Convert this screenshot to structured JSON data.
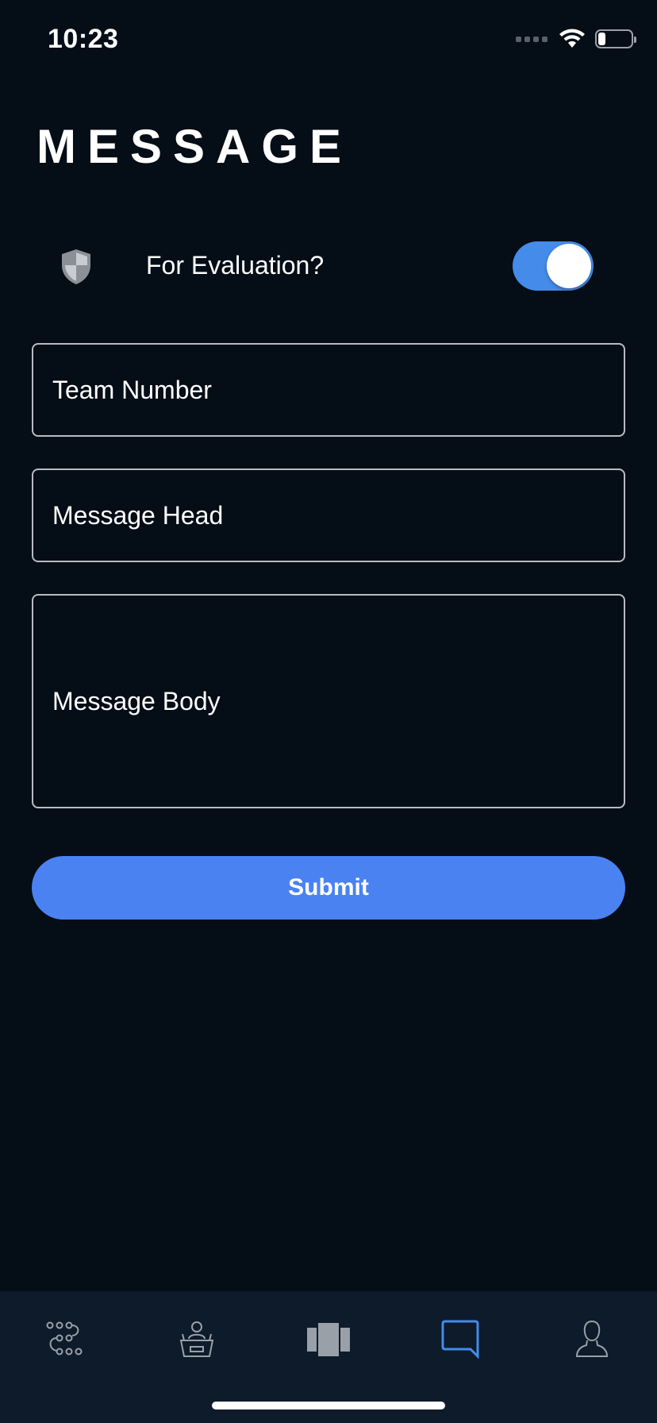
{
  "status_bar": {
    "time": "10:23"
  },
  "page": {
    "title": "MESSAGE"
  },
  "evaluation": {
    "label": "For Evaluation?",
    "toggle_on": true,
    "icon": "shield-icon"
  },
  "form": {
    "team_number_placeholder": "Team Number",
    "message_head_placeholder": "Message Head",
    "message_body_placeholder": "Message Body",
    "submit_label": "Submit"
  },
  "tab_bar": {
    "items": [
      {
        "icon": "route-icon",
        "active": false
      },
      {
        "icon": "presenter-icon",
        "active": false
      },
      {
        "icon": "gallery-icon",
        "active": false
      },
      {
        "icon": "chat-bubble-icon",
        "active": true
      },
      {
        "icon": "user-icon",
        "active": false
      }
    ]
  },
  "colors": {
    "background": "#050d17",
    "accent": "#4a82f2",
    "toggle": "#448bea",
    "tab_bar": "#0d1b2a",
    "icon_inactive": "#9aa0a8"
  }
}
